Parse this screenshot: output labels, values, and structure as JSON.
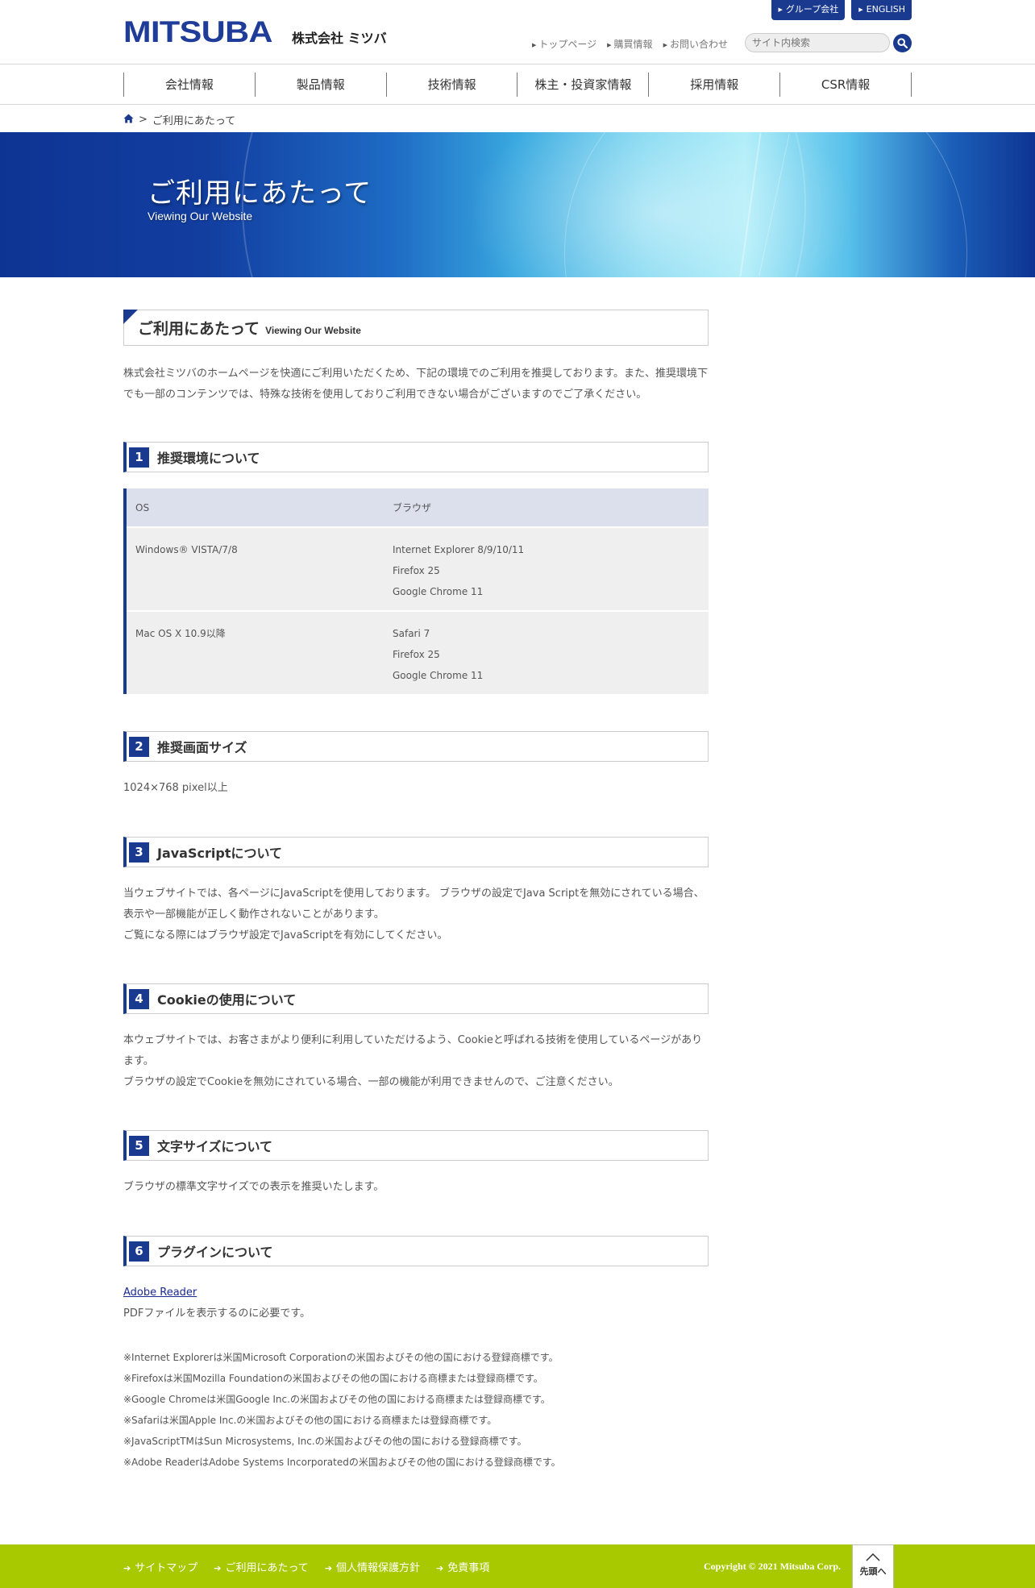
{
  "header": {
    "logo_text": "MITSUBA",
    "logo_sub": "株式会社 ミツバ",
    "top_buttons": [
      "グループ会社",
      "ENGLISH"
    ],
    "util_links": [
      "トップページ",
      "購買情報",
      "お問い合わせ"
    ],
    "search_placeholder": "サイト内検索"
  },
  "nav": [
    "会社情報",
    "製品情報",
    "技術情報",
    "株主・投資家情報",
    "採用情報",
    "CSR情報"
  ],
  "breadcrumb": {
    "sep": ">",
    "current": "ご利用にあたって"
  },
  "hero": {
    "title": "ご利用にあたって",
    "subtitle": "Viewing Our Website"
  },
  "page_heading": {
    "ja": "ご利用にあたって",
    "en": "Viewing Our Website"
  },
  "intro": "株式会社ミツバのホームページを快適にご利用いただくため、下記の環境でのご利用を推奨しております。また、推奨環境下でも一部のコンテンツでは、特殊な技術を使用しておりご利用できない場合がございますのでご了承ください。",
  "sections": [
    {
      "num": "1",
      "title": "推奨環境について"
    },
    {
      "num": "2",
      "title": "推奨画面サイズ"
    },
    {
      "num": "3",
      "title": "JavaScriptについて"
    },
    {
      "num": "4",
      "title": "Cookieの使用について"
    },
    {
      "num": "5",
      "title": "文字サイズについて"
    },
    {
      "num": "6",
      "title": "プラグインについて"
    }
  ],
  "env_table": {
    "headers": [
      "OS",
      "ブラウザ"
    ],
    "rows": [
      {
        "os": "Windows® VISTA/7/8",
        "browsers": [
          "Internet Explorer 8/9/10/11",
          "Firefox 25",
          "Google Chrome 11"
        ]
      },
      {
        "os": "Mac OS X 10.9以降",
        "browsers": [
          "Safari 7",
          "Firefox 25",
          "Google Chrome 11"
        ]
      }
    ]
  },
  "screen_size": "1024×768 pixel以上",
  "javascript": [
    "当ウェブサイトでは、各ページにJavaScriptを使用しております。 ブラウザの設定でJava Scriptを無効にされている場合、表示や一部機能が正しく動作されないことがあります。",
    "ご覧になる際にはブラウザ設定でJavaScriptを有効にしてください。"
  ],
  "cookie": [
    "本ウェブサイトでは、お客さまがより便利に利用していただけるよう、Cookieと呼ばれる技術を使用しているページがあります。",
    "ブラウザの設定でCookieを無効にされている場合、一部の機能が利用できませんので、ご注意ください。"
  ],
  "font_size": "ブラウザの標準文字サイズでの表示を推奨いたします。",
  "plugin": {
    "link": "Adobe Reader",
    "desc": "PDFファイルを表示するのに必要です。"
  },
  "notes": [
    "※Internet Explorerは米国Microsoft Corporationの米国およびその他の国における登録商標です。",
    "※Firefoxは米国Mozilla Foundationの米国およびその他の国における商標または登録商標です。",
    "※Google Chromeは米国Google Inc.の米国およびその他の国における商標または登録商標です。",
    "※Safariは米国Apple Inc.の米国およびその他の国における商標または登録商標です。",
    "※JavaScriptTMはSun Microsystems, Inc.の米国およびその他の国における登録商標です。",
    "※Adobe ReaderはAdobe Systems Incorporatedの米国およびその他の国における登録商標です。"
  ],
  "footer": {
    "links": [
      "サイトマップ",
      "ご利用にあたって",
      "個人情報保護方針",
      "免責事項"
    ],
    "copyright": "Copyright © 2021 Mitsuba Corp.",
    "pagetop": "先頭へ"
  },
  "colors": {
    "brand": "#1a3a8f",
    "footer": "#a8c800",
    "table_head": "#dce0ed",
    "table_body": "#efefef"
  }
}
